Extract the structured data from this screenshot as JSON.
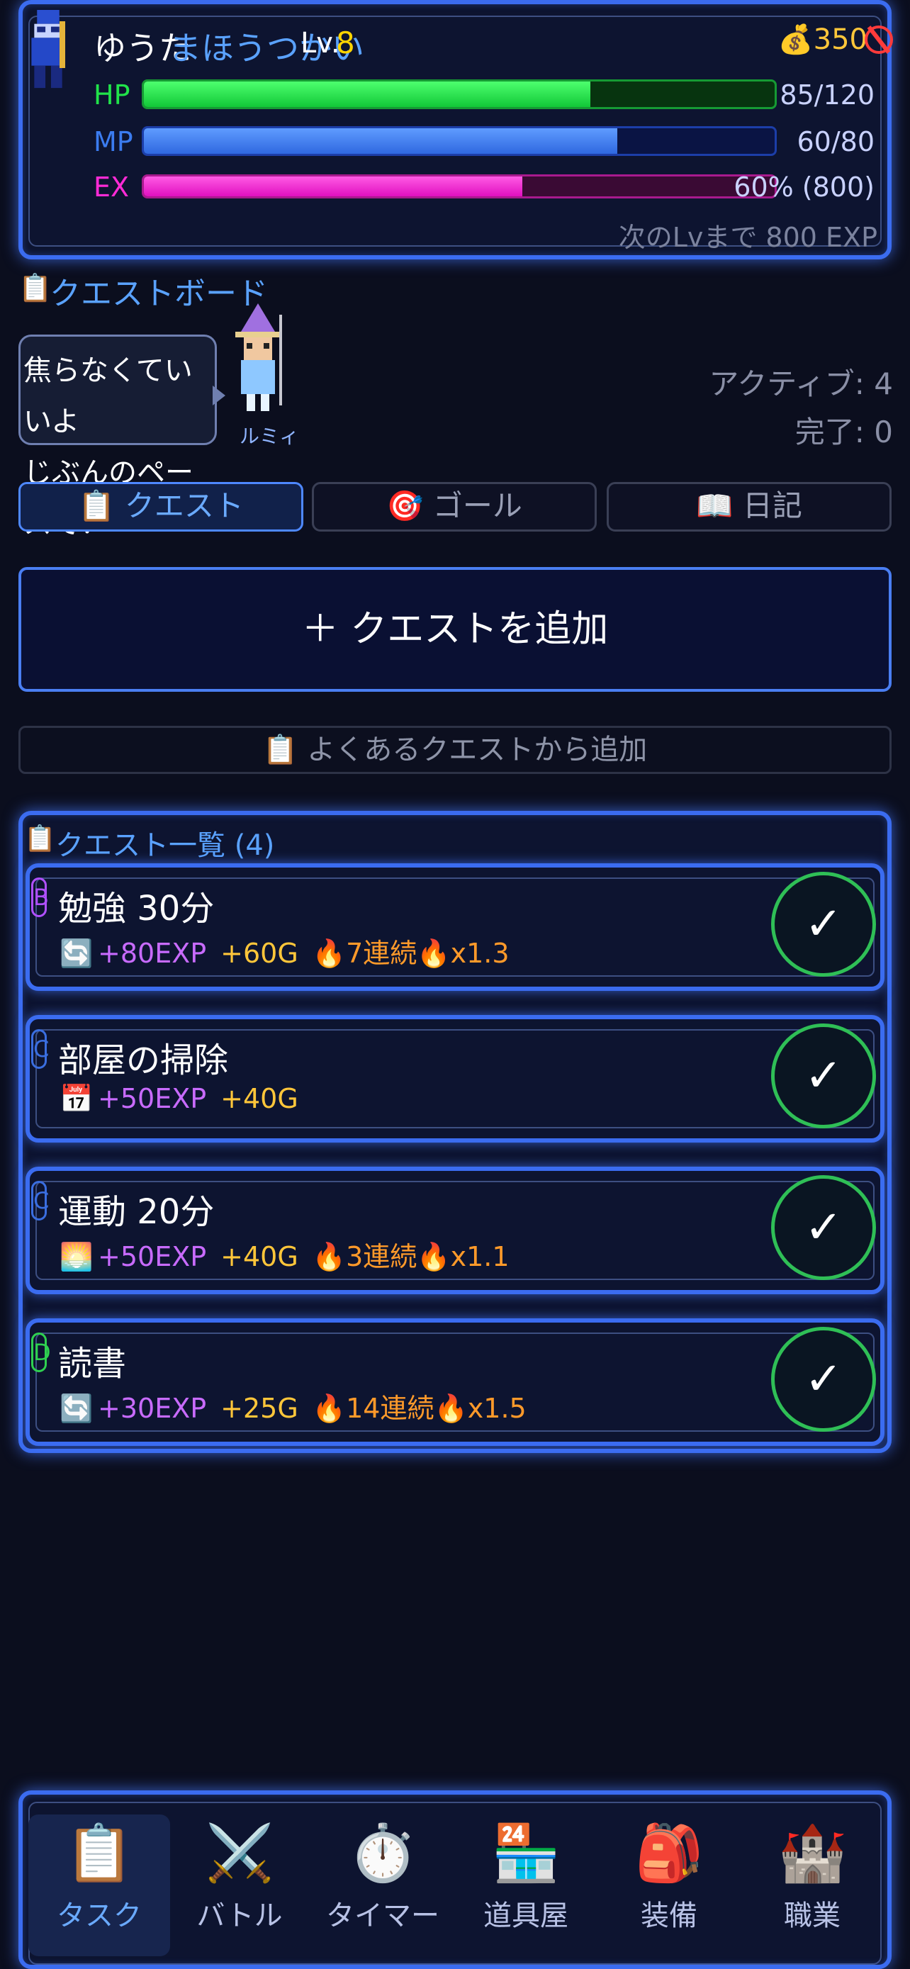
{
  "player": {
    "name": "ゆうた",
    "class": "まほうつかい",
    "lv_label": "Lv.",
    "lv": "8",
    "gold": "350"
  },
  "stats": {
    "hp": {
      "label": "HP",
      "value": "85/120",
      "fraction": 0.708,
      "color": "#21e34a"
    },
    "mp": {
      "label": "MP",
      "value": "60/80",
      "fraction": 0.75,
      "color": "#3b7cf0"
    },
    "ex": {
      "label": "EX",
      "value": "60% (800)",
      "fraction": 0.6,
      "color": "#ff2bd6"
    },
    "next_level": "次のLvまで 800 EXP"
  },
  "board": {
    "title": "クエストボード",
    "bubble_line1": "焦らなくていいよ",
    "bubble_line2": "じぶんのペースで！",
    "companion_name": "ルミィ",
    "active": "アクティブ: 4",
    "done": "完了: 0"
  },
  "tabs": [
    {
      "label": "クエスト",
      "icon": "clipboard-icon"
    },
    {
      "label": "ゴール",
      "icon": "target-icon"
    },
    {
      "label": "日記",
      "icon": "book-icon"
    }
  ],
  "actions": {
    "add_quest": "＋ クエストを追加",
    "add_common": "よくあるクエストから追加"
  },
  "quest_list": {
    "title": "クエスト一覧 (4)",
    "items": [
      {
        "rank": "B",
        "rank_color": "#b050ff",
        "title": "勉強 30分",
        "type_icon": "repeat-icon",
        "exp": "+80EXP",
        "gold": "+60G",
        "streak": "🔥7連続🔥x1.3"
      },
      {
        "rank": "C",
        "rank_color": "#3a6ee0",
        "title": "部屋の掃除",
        "type_icon": "calendar-icon",
        "exp": "+50EXP",
        "gold": "+40G",
        "streak": ""
      },
      {
        "rank": "C",
        "rank_color": "#3a6ee0",
        "title": "運動 20分",
        "type_icon": "sunrise-icon",
        "exp": "+50EXP",
        "gold": "+40G",
        "streak": "🔥3連続🔥x1.1"
      },
      {
        "rank": "D",
        "rank_color": "#2fd050",
        "title": "読書",
        "type_icon": "repeat-icon",
        "exp": "+30EXP",
        "gold": "+25G",
        "streak": "🔥14連続🔥x1.5"
      }
    ],
    "check_glyph": "✓"
  },
  "nav": [
    {
      "label": "タスク",
      "icon": "clipboard-icon"
    },
    {
      "label": "バトル",
      "icon": "crossed-swords-icon"
    },
    {
      "label": "タイマー",
      "icon": "stopwatch-icon"
    },
    {
      "label": "道具屋",
      "icon": "convenience-store-icon"
    },
    {
      "label": "装備",
      "icon": "backpack-icon"
    },
    {
      "label": "職業",
      "icon": "castle-icon"
    }
  ]
}
